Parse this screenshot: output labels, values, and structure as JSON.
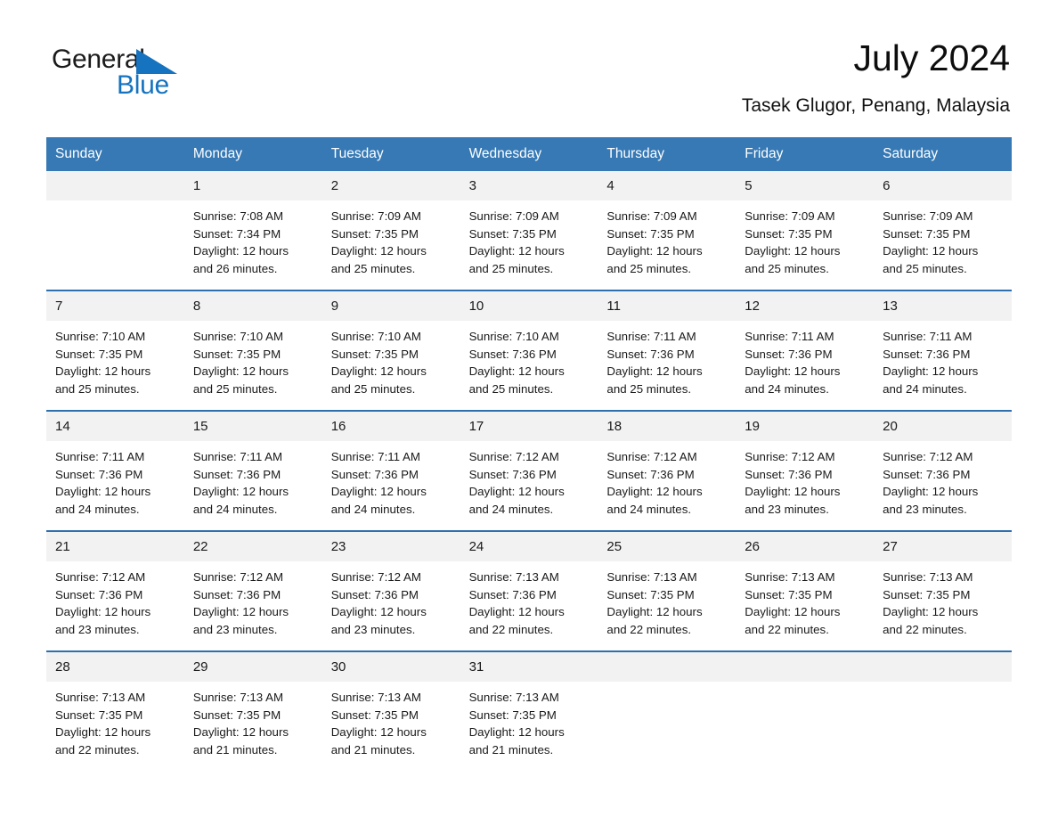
{
  "brand": {
    "name_part1": "General",
    "name_part2": "Blue",
    "flag_icon": "triangle-flag-icon",
    "accent_color": "#1573c0"
  },
  "header": {
    "title": "July 2024",
    "location": "Tasek Glugor, Penang, Malaysia"
  },
  "theme": {
    "header_blue": "#3679b5",
    "row_border_blue": "#2f6fae",
    "day_number_bg": "#f2f2f2",
    "page_bg": "#ffffff"
  },
  "calendar": {
    "weekdays": [
      "Sunday",
      "Monday",
      "Tuesday",
      "Wednesday",
      "Thursday",
      "Friday",
      "Saturday"
    ],
    "weeks": [
      [
        {
          "day": "",
          "empty": true,
          "sunrise": "",
          "sunset": "",
          "daylight_line1": "",
          "daylight_line2": ""
        },
        {
          "day": "1",
          "sunrise": "Sunrise: 7:08 AM",
          "sunset": "Sunset: 7:34 PM",
          "daylight_line1": "Daylight: 12 hours",
          "daylight_line2": "and 26 minutes."
        },
        {
          "day": "2",
          "sunrise": "Sunrise: 7:09 AM",
          "sunset": "Sunset: 7:35 PM",
          "daylight_line1": "Daylight: 12 hours",
          "daylight_line2": "and 25 minutes."
        },
        {
          "day": "3",
          "sunrise": "Sunrise: 7:09 AM",
          "sunset": "Sunset: 7:35 PM",
          "daylight_line1": "Daylight: 12 hours",
          "daylight_line2": "and 25 minutes."
        },
        {
          "day": "4",
          "sunrise": "Sunrise: 7:09 AM",
          "sunset": "Sunset: 7:35 PM",
          "daylight_line1": "Daylight: 12 hours",
          "daylight_line2": "and 25 minutes."
        },
        {
          "day": "5",
          "sunrise": "Sunrise: 7:09 AM",
          "sunset": "Sunset: 7:35 PM",
          "daylight_line1": "Daylight: 12 hours",
          "daylight_line2": "and 25 minutes."
        },
        {
          "day": "6",
          "sunrise": "Sunrise: 7:09 AM",
          "sunset": "Sunset: 7:35 PM",
          "daylight_line1": "Daylight: 12 hours",
          "daylight_line2": "and 25 minutes."
        }
      ],
      [
        {
          "day": "7",
          "sunrise": "Sunrise: 7:10 AM",
          "sunset": "Sunset: 7:35 PM",
          "daylight_line1": "Daylight: 12 hours",
          "daylight_line2": "and 25 minutes."
        },
        {
          "day": "8",
          "sunrise": "Sunrise: 7:10 AM",
          "sunset": "Sunset: 7:35 PM",
          "daylight_line1": "Daylight: 12 hours",
          "daylight_line2": "and 25 minutes."
        },
        {
          "day": "9",
          "sunrise": "Sunrise: 7:10 AM",
          "sunset": "Sunset: 7:35 PM",
          "daylight_line1": "Daylight: 12 hours",
          "daylight_line2": "and 25 minutes."
        },
        {
          "day": "10",
          "sunrise": "Sunrise: 7:10 AM",
          "sunset": "Sunset: 7:36 PM",
          "daylight_line1": "Daylight: 12 hours",
          "daylight_line2": "and 25 minutes."
        },
        {
          "day": "11",
          "sunrise": "Sunrise: 7:11 AM",
          "sunset": "Sunset: 7:36 PM",
          "daylight_line1": "Daylight: 12 hours",
          "daylight_line2": "and 25 minutes."
        },
        {
          "day": "12",
          "sunrise": "Sunrise: 7:11 AM",
          "sunset": "Sunset: 7:36 PM",
          "daylight_line1": "Daylight: 12 hours",
          "daylight_line2": "and 24 minutes."
        },
        {
          "day": "13",
          "sunrise": "Sunrise: 7:11 AM",
          "sunset": "Sunset: 7:36 PM",
          "daylight_line1": "Daylight: 12 hours",
          "daylight_line2": "and 24 minutes."
        }
      ],
      [
        {
          "day": "14",
          "sunrise": "Sunrise: 7:11 AM",
          "sunset": "Sunset: 7:36 PM",
          "daylight_line1": "Daylight: 12 hours",
          "daylight_line2": "and 24 minutes."
        },
        {
          "day": "15",
          "sunrise": "Sunrise: 7:11 AM",
          "sunset": "Sunset: 7:36 PM",
          "daylight_line1": "Daylight: 12 hours",
          "daylight_line2": "and 24 minutes."
        },
        {
          "day": "16",
          "sunrise": "Sunrise: 7:11 AM",
          "sunset": "Sunset: 7:36 PM",
          "daylight_line1": "Daylight: 12 hours",
          "daylight_line2": "and 24 minutes."
        },
        {
          "day": "17",
          "sunrise": "Sunrise: 7:12 AM",
          "sunset": "Sunset: 7:36 PM",
          "daylight_line1": "Daylight: 12 hours",
          "daylight_line2": "and 24 minutes."
        },
        {
          "day": "18",
          "sunrise": "Sunrise: 7:12 AM",
          "sunset": "Sunset: 7:36 PM",
          "daylight_line1": "Daylight: 12 hours",
          "daylight_line2": "and 24 minutes."
        },
        {
          "day": "19",
          "sunrise": "Sunrise: 7:12 AM",
          "sunset": "Sunset: 7:36 PM",
          "daylight_line1": "Daylight: 12 hours",
          "daylight_line2": "and 23 minutes."
        },
        {
          "day": "20",
          "sunrise": "Sunrise: 7:12 AM",
          "sunset": "Sunset: 7:36 PM",
          "daylight_line1": "Daylight: 12 hours",
          "daylight_line2": "and 23 minutes."
        }
      ],
      [
        {
          "day": "21",
          "sunrise": "Sunrise: 7:12 AM",
          "sunset": "Sunset: 7:36 PM",
          "daylight_line1": "Daylight: 12 hours",
          "daylight_line2": "and 23 minutes."
        },
        {
          "day": "22",
          "sunrise": "Sunrise: 7:12 AM",
          "sunset": "Sunset: 7:36 PM",
          "daylight_line1": "Daylight: 12 hours",
          "daylight_line2": "and 23 minutes."
        },
        {
          "day": "23",
          "sunrise": "Sunrise: 7:12 AM",
          "sunset": "Sunset: 7:36 PM",
          "daylight_line1": "Daylight: 12 hours",
          "daylight_line2": "and 23 minutes."
        },
        {
          "day": "24",
          "sunrise": "Sunrise: 7:13 AM",
          "sunset": "Sunset: 7:36 PM",
          "daylight_line1": "Daylight: 12 hours",
          "daylight_line2": "and 22 minutes."
        },
        {
          "day": "25",
          "sunrise": "Sunrise: 7:13 AM",
          "sunset": "Sunset: 7:35 PM",
          "daylight_line1": "Daylight: 12 hours",
          "daylight_line2": "and 22 minutes."
        },
        {
          "day": "26",
          "sunrise": "Sunrise: 7:13 AM",
          "sunset": "Sunset: 7:35 PM",
          "daylight_line1": "Daylight: 12 hours",
          "daylight_line2": "and 22 minutes."
        },
        {
          "day": "27",
          "sunrise": "Sunrise: 7:13 AM",
          "sunset": "Sunset: 7:35 PM",
          "daylight_line1": "Daylight: 12 hours",
          "daylight_line2": "and 22 minutes."
        }
      ],
      [
        {
          "day": "28",
          "sunrise": "Sunrise: 7:13 AM",
          "sunset": "Sunset: 7:35 PM",
          "daylight_line1": "Daylight: 12 hours",
          "daylight_line2": "and 22 minutes."
        },
        {
          "day": "29",
          "sunrise": "Sunrise: 7:13 AM",
          "sunset": "Sunset: 7:35 PM",
          "daylight_line1": "Daylight: 12 hours",
          "daylight_line2": "and 21 minutes."
        },
        {
          "day": "30",
          "sunrise": "Sunrise: 7:13 AM",
          "sunset": "Sunset: 7:35 PM",
          "daylight_line1": "Daylight: 12 hours",
          "daylight_line2": "and 21 minutes."
        },
        {
          "day": "31",
          "sunrise": "Sunrise: 7:13 AM",
          "sunset": "Sunset: 7:35 PM",
          "daylight_line1": "Daylight: 12 hours",
          "daylight_line2": "and 21 minutes."
        },
        {
          "day": "",
          "empty": true,
          "sunrise": "",
          "sunset": "",
          "daylight_line1": "",
          "daylight_line2": ""
        },
        {
          "day": "",
          "empty": true,
          "sunrise": "",
          "sunset": "",
          "daylight_line1": "",
          "daylight_line2": ""
        },
        {
          "day": "",
          "empty": true,
          "sunrise": "",
          "sunset": "",
          "daylight_line1": "",
          "daylight_line2": ""
        }
      ]
    ]
  }
}
